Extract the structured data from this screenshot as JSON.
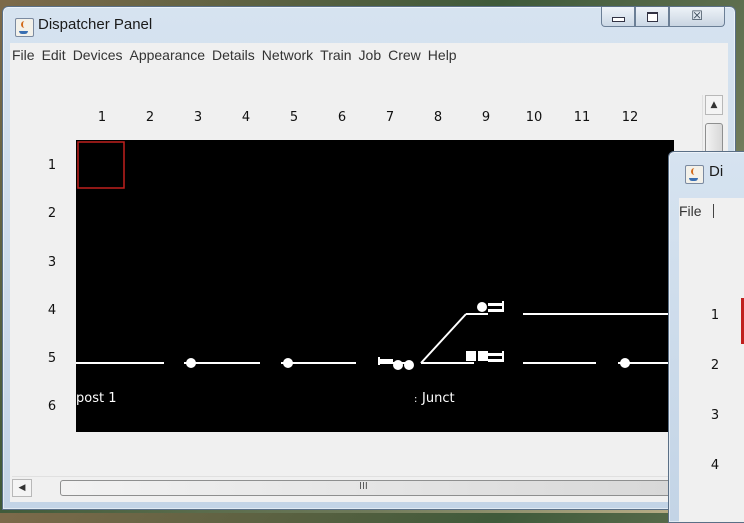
{
  "window1": {
    "title": "Dispatcher Panel",
    "menu": [
      "File",
      "Edit",
      "Devices",
      "Appearance",
      "Details",
      "Network",
      "Train",
      "Job",
      "Crew",
      "Help"
    ],
    "columns": [
      "1",
      "2",
      "3",
      "4",
      "5",
      "6",
      "7",
      "8",
      "9",
      "10",
      "11",
      "12"
    ],
    "rows": [
      "1",
      "2",
      "3",
      "4",
      "5",
      "6"
    ],
    "panel_labels": {
      "left": "post 1",
      "junction": "Junct"
    },
    "hscroll_grip": "III",
    "scroll_up": "▲",
    "scroll_left": "◀",
    "minimize_icon": "minimize-icon",
    "maximize_icon": "maximize-icon",
    "close_glyph": "☒"
  },
  "window2": {
    "title_partial": "Di",
    "menu_partial": "File",
    "rows": [
      "1",
      "2",
      "3",
      "4"
    ]
  },
  "colors": {
    "panel_bg": "#000000",
    "track": "#ffffff",
    "selection": "#c0201e",
    "chrome": "#f0f0f0"
  }
}
